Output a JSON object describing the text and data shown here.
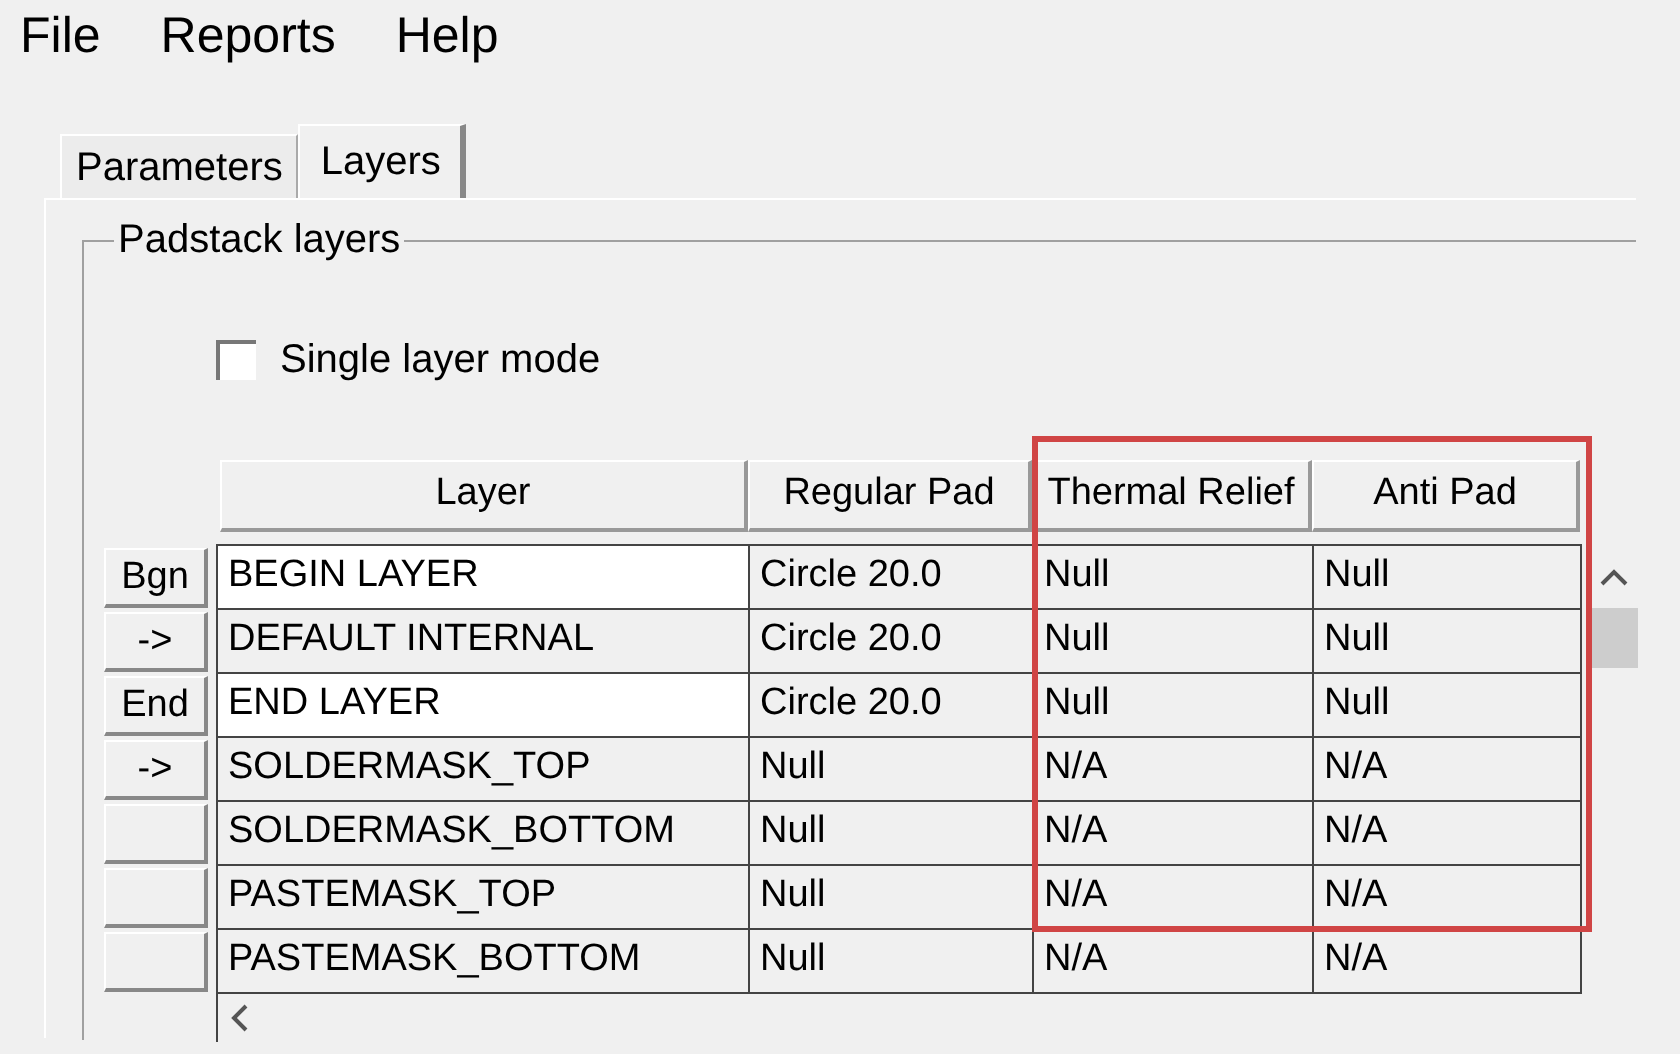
{
  "menu": [
    "File",
    "Reports",
    "Help"
  ],
  "tabs": [
    {
      "label": "Parameters",
      "selected": false
    },
    {
      "label": "Layers",
      "selected": true
    }
  ],
  "group": {
    "title": "Padstack layers",
    "checkbox": {
      "label": "Single layer mode",
      "checked": false
    }
  },
  "table": {
    "columns": [
      "Layer",
      "Regular Pad",
      "Thermal Relief",
      "Anti Pad"
    ],
    "rows": [
      {
        "button": "Bgn",
        "editable": true,
        "cells": [
          "BEGIN LAYER",
          "Circle 20.0",
          "Null",
          "Null"
        ]
      },
      {
        "button": "->",
        "editable": false,
        "cells": [
          "DEFAULT INTERNAL",
          "Circle 20.0",
          "Null",
          "Null"
        ]
      },
      {
        "button": "End",
        "editable": true,
        "cells": [
          "END LAYER",
          "Circle 20.0",
          "Null",
          "Null"
        ]
      },
      {
        "button": "->",
        "editable": false,
        "cells": [
          "SOLDERMASK_TOP",
          "Null",
          "N/A",
          "N/A"
        ]
      },
      {
        "editable": false,
        "cells": [
          "SOLDERMASK_BOTTOM",
          "Null",
          "N/A",
          "N/A"
        ]
      },
      {
        "editable": false,
        "cells": [
          "PASTEMASK_TOP",
          "Null",
          "N/A",
          "N/A"
        ]
      },
      {
        "editable": false,
        "cells": [
          "PASTEMASK_BOTTOM",
          "Null",
          "N/A",
          "N/A"
        ]
      }
    ]
  }
}
